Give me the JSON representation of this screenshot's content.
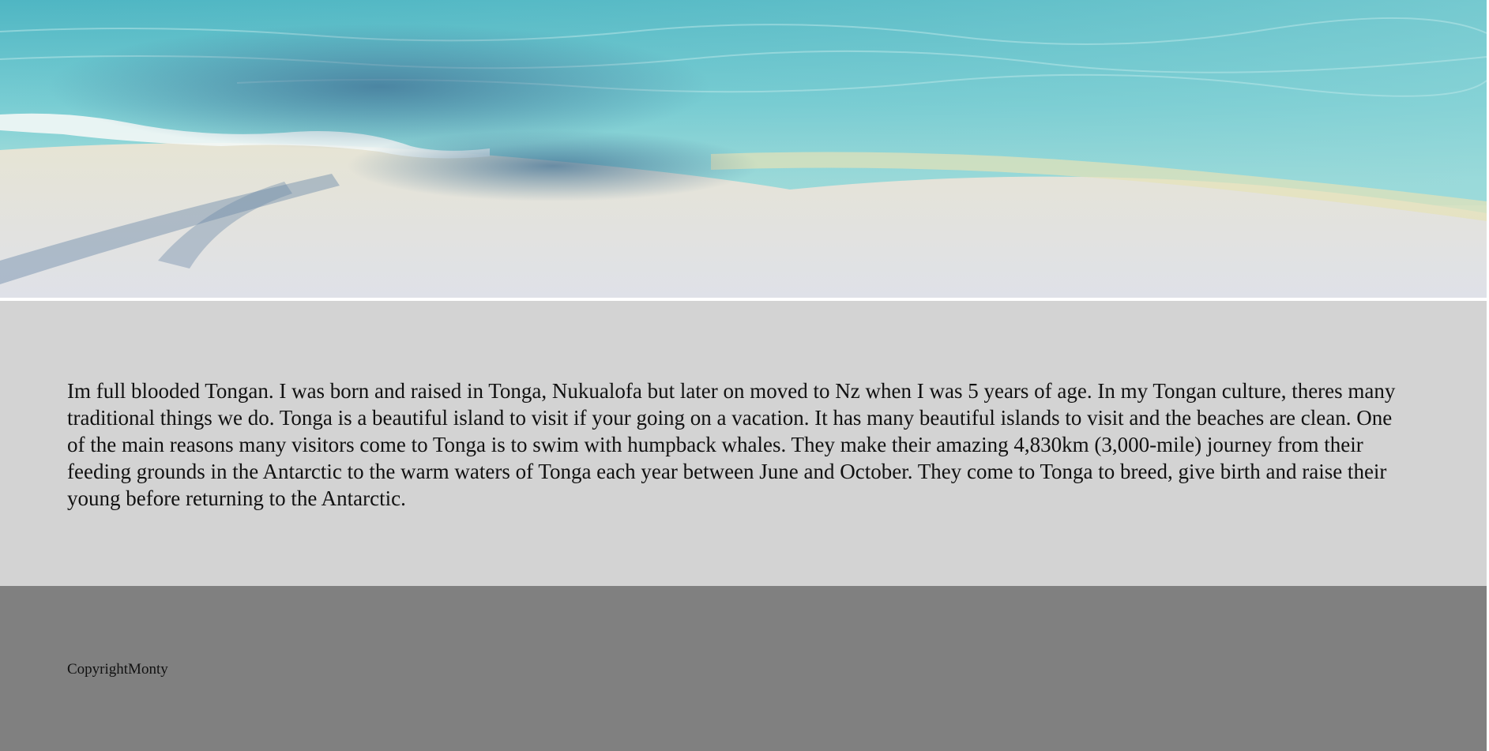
{
  "hero": {
    "image_alt": "beach"
  },
  "main": {
    "paragraph": "Im full blooded Tongan. I was born and raised in Tonga, Nukualofa but later on moved to Nz when I was 5 years of age. In my Tongan culture, theres many traditional things we do. Tonga is a beautiful island to visit if your going on a vacation. It has many beautiful islands to visit and the beaches are clean. One of the main reasons many visitors come to Tonga is to swim with humpback whales. They make their amazing 4,830km (3,000-mile) journey from their feeding grounds in the Antarctic to the warm waters of Tonga each year between June and October. They come to Tonga to breed, give birth and raise their young before returning to the Antarctic."
  },
  "footer": {
    "copyright": "CopyrightMonty"
  },
  "colors": {
    "content_bg": "#d3d3d3",
    "footer_bg": "#808080",
    "text": "#111111"
  }
}
